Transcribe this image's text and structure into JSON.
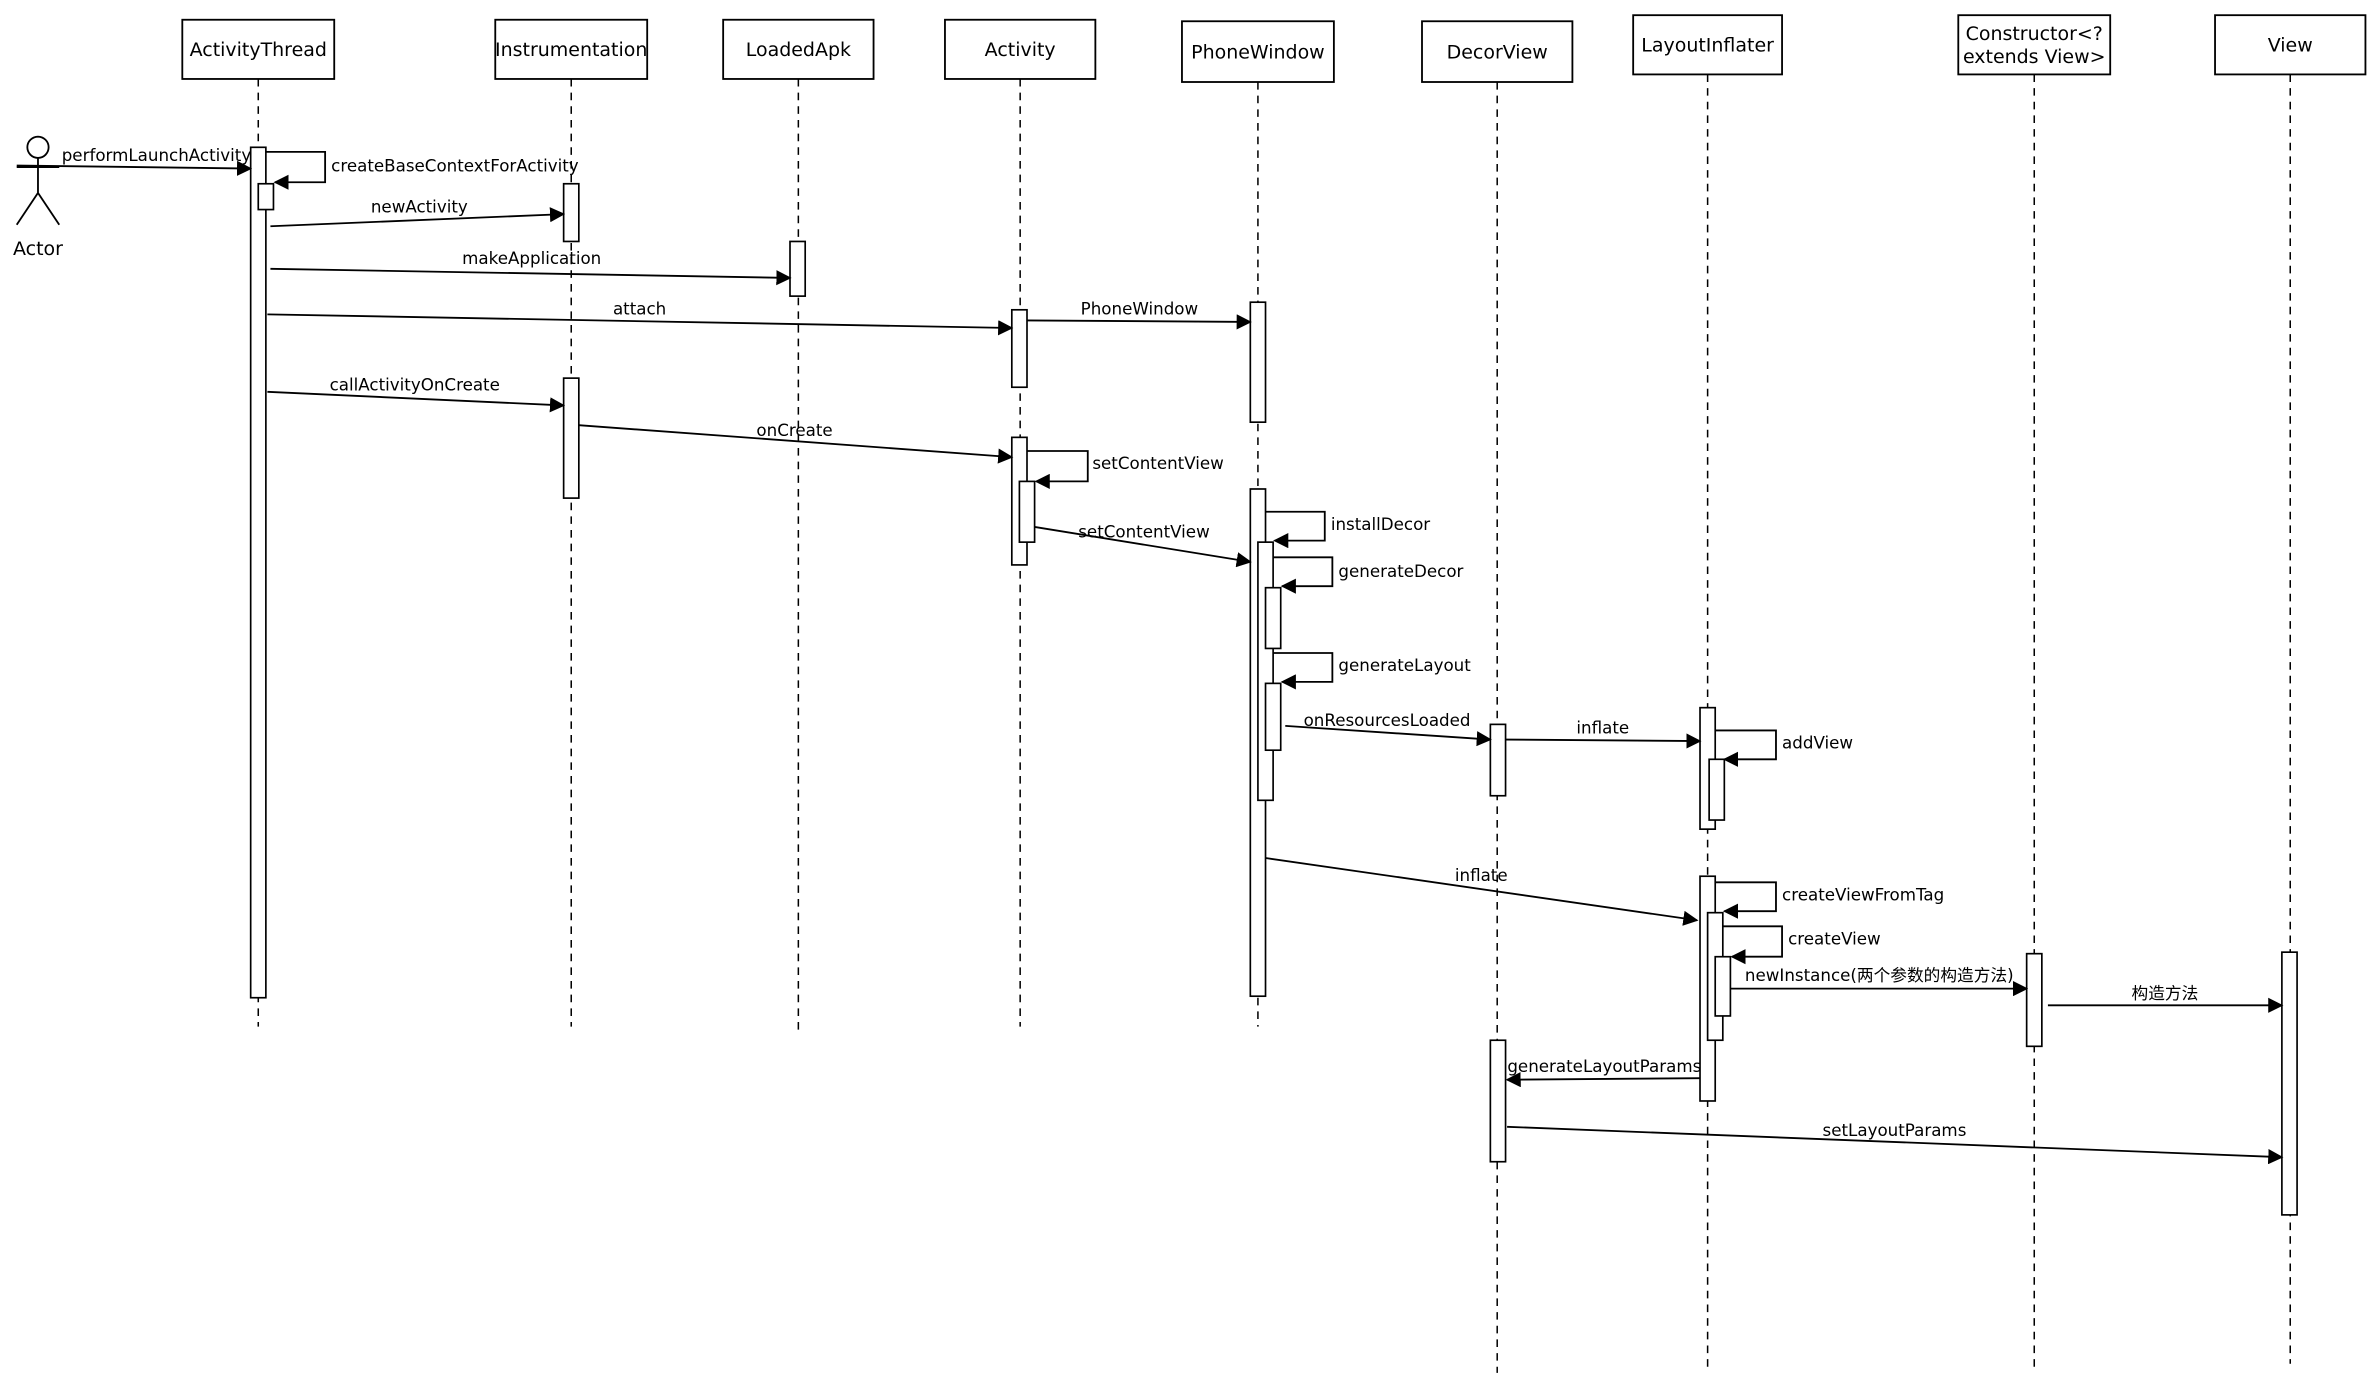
{
  "diagram": {
    "type": "UML sequence diagram",
    "actor": {
      "label": "Actor"
    },
    "participants": [
      {
        "id": "activity-thread",
        "label": [
          "ActivityThread"
        ]
      },
      {
        "id": "instrumentation",
        "label": [
          "Instrumentation"
        ]
      },
      {
        "id": "loaded-apk",
        "label": [
          "LoadedApk"
        ]
      },
      {
        "id": "activity",
        "label": [
          "Activity"
        ]
      },
      {
        "id": "phone-window",
        "label": [
          "PhoneWindow"
        ]
      },
      {
        "id": "decor-view",
        "label": [
          "DecorView"
        ]
      },
      {
        "id": "layout-inflater",
        "label": [
          "LayoutInflater"
        ]
      },
      {
        "id": "constructor",
        "label": [
          "Constructor<?",
          "extends View>"
        ]
      },
      {
        "id": "view",
        "label": [
          "View"
        ]
      }
    ],
    "messages": [
      {
        "label": "performLaunchActivity",
        "from": "actor",
        "to": "activity-thread",
        "kind": "call"
      },
      {
        "label": "createBaseContextForActivity",
        "from": "activity-thread",
        "to": "activity-thread",
        "kind": "self"
      },
      {
        "label": "newActivity",
        "from": "activity-thread",
        "to": "instrumentation",
        "kind": "call"
      },
      {
        "label": "makeApplication",
        "from": "activity-thread",
        "to": "loaded-apk",
        "kind": "call"
      },
      {
        "label": "attach",
        "from": "activity-thread",
        "to": "activity",
        "kind": "call"
      },
      {
        "label": "PhoneWindow",
        "from": "activity",
        "to": "phone-window",
        "kind": "call"
      },
      {
        "label": "callActivityOnCreate",
        "from": "activity-thread",
        "to": "instrumentation",
        "kind": "call"
      },
      {
        "label": "onCreate",
        "from": "instrumentation",
        "to": "activity",
        "kind": "call"
      },
      {
        "label": "setContentView",
        "from": "activity",
        "to": "activity",
        "kind": "self"
      },
      {
        "label": "setContentView",
        "from": "activity",
        "to": "phone-window",
        "kind": "call"
      },
      {
        "label": "installDecor",
        "from": "phone-window",
        "to": "phone-window",
        "kind": "self"
      },
      {
        "label": "generateDecor",
        "from": "phone-window",
        "to": "phone-window",
        "kind": "self"
      },
      {
        "label": "generateLayout",
        "from": "phone-window",
        "to": "phone-window",
        "kind": "self"
      },
      {
        "label": "onResourcesLoaded",
        "from": "phone-window",
        "to": "decor-view",
        "kind": "call"
      },
      {
        "label": "inflate",
        "from": "decor-view",
        "to": "layout-inflater",
        "kind": "call"
      },
      {
        "label": "addView",
        "from": "layout-inflater",
        "to": "layout-inflater",
        "kind": "self"
      },
      {
        "label": "inflate",
        "from": "phone-window",
        "to": "layout-inflater",
        "kind": "call"
      },
      {
        "label": "createViewFromTag",
        "from": "layout-inflater",
        "to": "layout-inflater",
        "kind": "self"
      },
      {
        "label": "createView",
        "from": "layout-inflater",
        "to": "layout-inflater",
        "kind": "self"
      },
      {
        "label": "newInstance(两个参数的构造方法)",
        "from": "layout-inflater",
        "to": "constructor",
        "kind": "call"
      },
      {
        "label": "构造方法",
        "from": "constructor",
        "to": "view",
        "kind": "call"
      },
      {
        "label": "generateLayoutParams",
        "from": "layout-inflater",
        "to": "decor-view",
        "kind": "call"
      },
      {
        "label": "setLayoutParams",
        "from": "decor-view",
        "to": "view",
        "kind": "call"
      }
    ]
  }
}
